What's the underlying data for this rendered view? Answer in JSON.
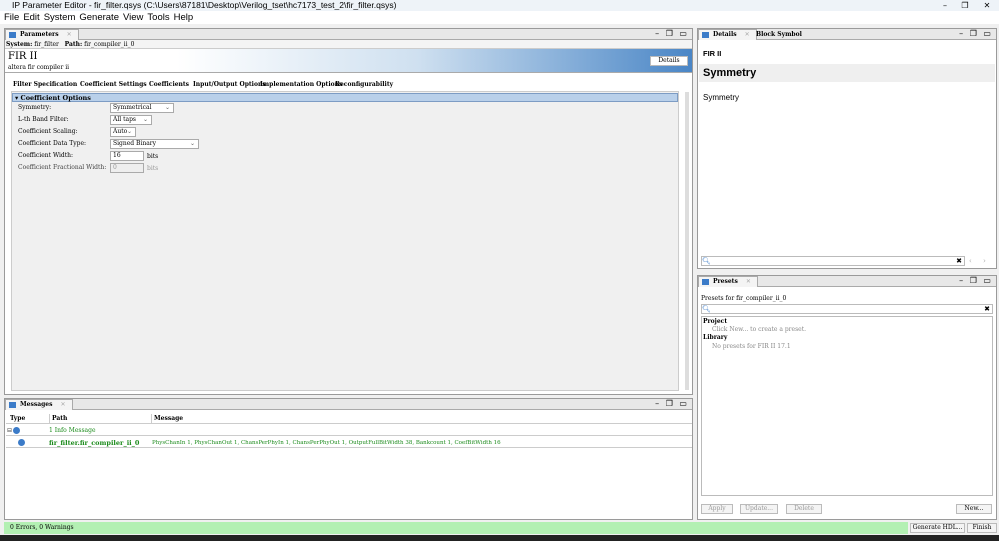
{
  "window": {
    "title": "IP Parameter Editor - fir_filter.qsys (C:\\Users\\87181\\Desktop\\Verilog_tset\\hc7173_test_2\\fir_filter.qsys)"
  },
  "menu": [
    "File",
    "Edit",
    "System",
    "Generate",
    "View",
    "Tools",
    "Help"
  ],
  "parameters": {
    "tab": "Parameters",
    "system_label": "System:",
    "system": "fir_filter",
    "path_label": "Path:",
    "path": "fir_compiler_ii_0",
    "ip_title": "FIR II",
    "ip_subtitle": "altera fir compiler ii",
    "details_button": "Details",
    "tabs": [
      "Filter Specification",
      "Coefficient Settings",
      "Coefficients",
      "Input/Output Options",
      "Implementation Options",
      "Reconfigurability"
    ],
    "section": "Coefficient Options",
    "fields": [
      {
        "label": "Symmetry:",
        "value": "Symmetrical"
      },
      {
        "label": "L-th Band Filter:",
        "value": "All taps"
      },
      {
        "label": "Coefficient Scaling:",
        "value": "Auto"
      },
      {
        "label": "Coefficient Data Type:",
        "value": "Signed Binary"
      },
      {
        "label": "Coefficient Width:",
        "value": "16",
        "unit": "bits"
      },
      {
        "label": "Coefficient Fractional Width:",
        "value": "0",
        "unit": "bits"
      }
    ]
  },
  "messages": {
    "tab": "Messages",
    "headers": [
      "Type",
      "Path",
      "Message"
    ],
    "summary": "1 Info Message",
    "row": {
      "path": "fir_filter.fir_compiler_ii_0",
      "message": "PhysChanIn 1, PhysChanOut 1, ChansPerPhyIn 1, ChansPerPhyOut 1, OutputFullBitWidth 38, Bankcount 1, CoefBitWidth 16"
    }
  },
  "status": {
    "text": "0 Errors, 0 Warnings",
    "generate": "Generate HDL...",
    "finish": "Finish"
  },
  "details": {
    "tabs": [
      "Details",
      "Block Symbol"
    ],
    "crumb": "FIR II",
    "heading": "Symmetry",
    "body": "Symmetry"
  },
  "presets": {
    "tab": "Presets",
    "label": "Presets for fir_compiler_ii_0",
    "project": "Project",
    "project_hint": "Click New... to create a preset.",
    "library": "Library",
    "library_hint": "No presets for FIR II 17.1",
    "buttons": [
      "Apply",
      "Update...",
      "Delete",
      "New..."
    ]
  }
}
